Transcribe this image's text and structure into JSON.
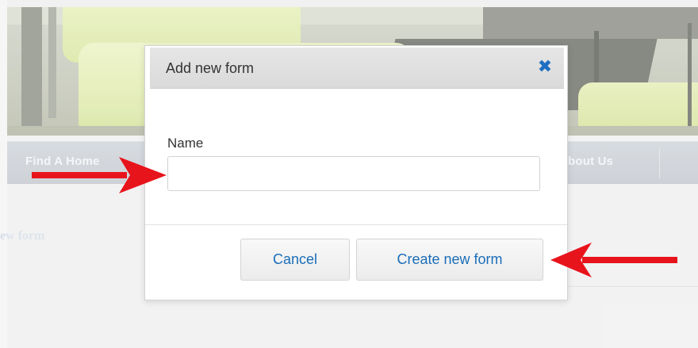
{
  "background": {
    "nav": {
      "find_label": "Find A Home",
      "about_label": "bout Us"
    },
    "heading": "ew form"
  },
  "modal": {
    "title": "Add new form",
    "close_icon": "close-icon",
    "field": {
      "label": "Name",
      "value": "",
      "placeholder": ""
    },
    "buttons": {
      "cancel": "Cancel",
      "create": "Create new form"
    }
  },
  "colors": {
    "accent": "#1e6fc1",
    "arrow": "#e8141c"
  }
}
